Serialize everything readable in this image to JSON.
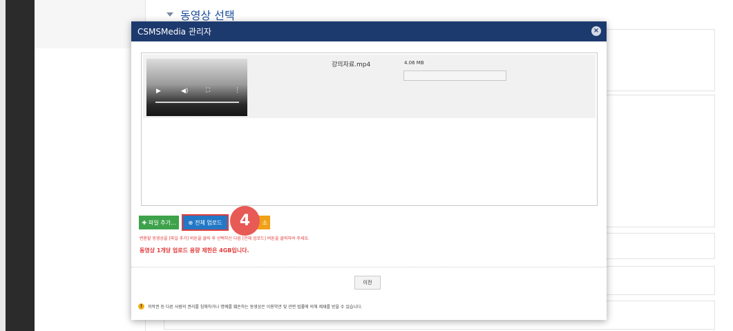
{
  "section": {
    "title": "동영상 선택"
  },
  "modal": {
    "title": "CSMSMedia 관리자",
    "close_icon": "×",
    "file": {
      "name": "강의자료.mp4",
      "size": "4.06 MB",
      "progress": 0
    },
    "video_controls": {
      "play": "▶",
      "volume": "◀)",
      "fullscreen": "⛶",
      "more": "⋮"
    },
    "buttons": {
      "add": "파일 추가...",
      "upload": "전체 업로드",
      "cancel": "소",
      "prev": "이전"
    },
    "step_badge": "4",
    "hint": "변환할 동영상을 [파일 추가] 버튼을 클릭 후 선택하신 다음 [전체 업로드] 버튼을 클릭하여 주세요.",
    "limit": "동영상 1개당 업로드 용량 제한은 4GB입니다.",
    "notice": "저작권 등 다른 사람의 권리를 침해하거나 명예를 훼손하는 동영상은 이용약관 및 관련 법률에 의해 제재를 받을 수 있습니다.",
    "notice_icon": "!"
  }
}
